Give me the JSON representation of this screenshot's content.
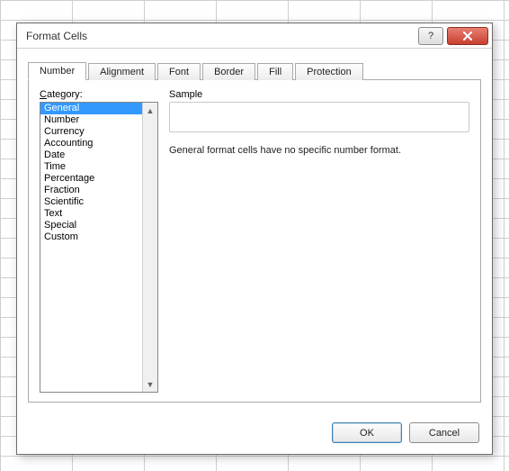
{
  "dialog": {
    "title": "Format Cells"
  },
  "tabs": [
    {
      "label": "Number",
      "active": true
    },
    {
      "label": "Alignment",
      "active": false
    },
    {
      "label": "Font",
      "active": false
    },
    {
      "label": "Border",
      "active": false
    },
    {
      "label": "Fill",
      "active": false
    },
    {
      "label": "Protection",
      "active": false
    }
  ],
  "category": {
    "label_prefix": "C",
    "label_rest": "ategory:",
    "items": [
      "General",
      "Number",
      "Currency",
      "Accounting",
      "Date",
      "Time",
      "Percentage",
      "Fraction",
      "Scientific",
      "Text",
      "Special",
      "Custom"
    ],
    "selected_index": 0
  },
  "sample": {
    "label": "Sample",
    "value": ""
  },
  "description": "General format cells have no specific number format.",
  "buttons": {
    "ok": "OK",
    "cancel": "Cancel"
  },
  "titlebar_icons": {
    "help": "?",
    "close": "✕"
  }
}
